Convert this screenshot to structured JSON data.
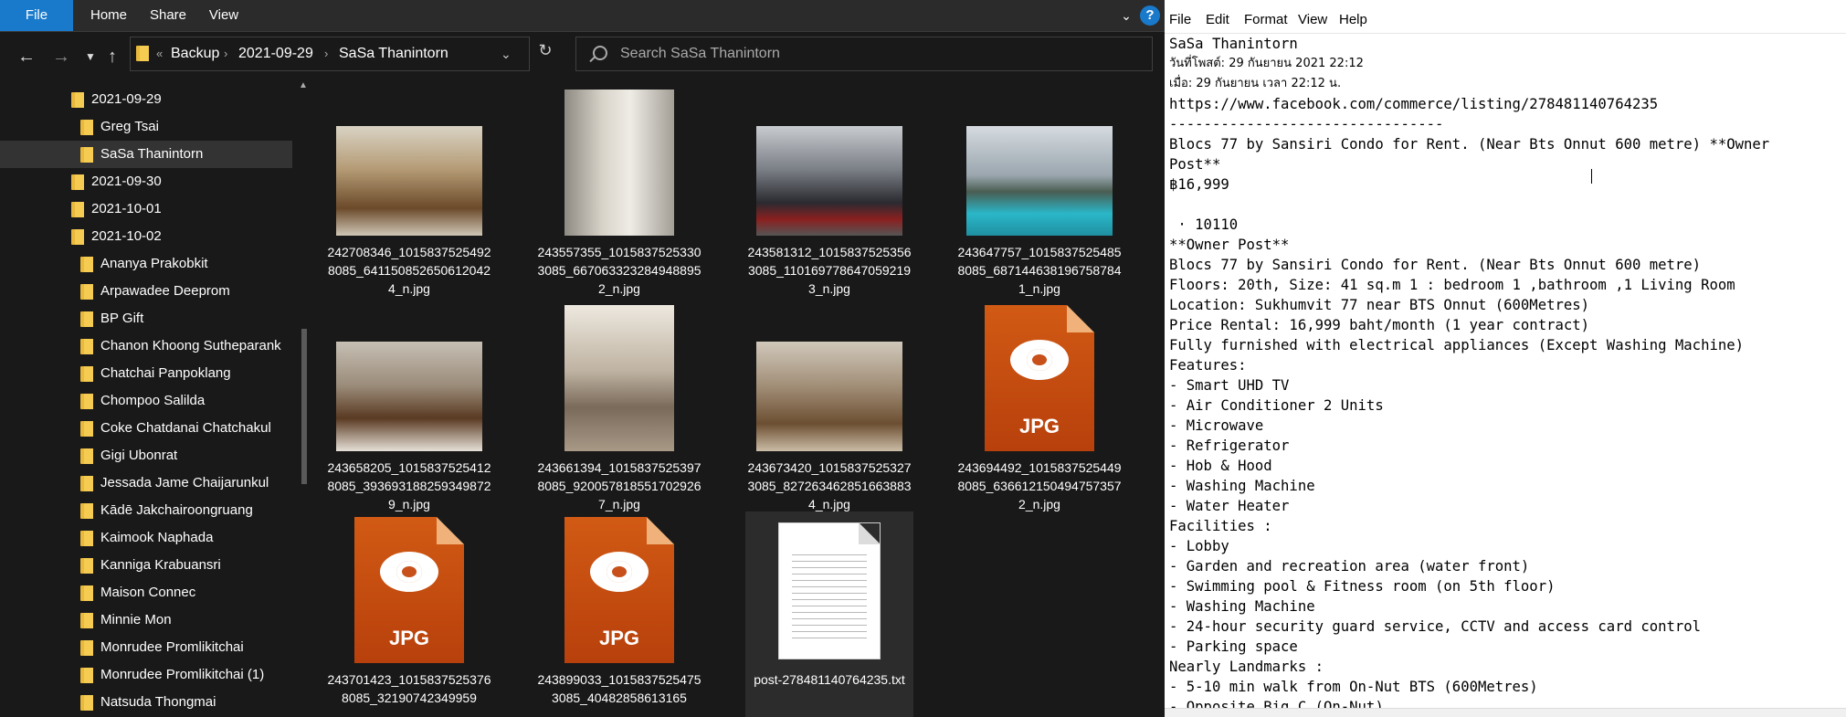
{
  "explorer": {
    "ribbon": {
      "file": "File",
      "home": "Home",
      "share": "Share",
      "view": "View",
      "help": "?"
    },
    "address": {
      "overflow": "«",
      "crumbs": [
        "Backup",
        "2021-09-29",
        "SaSa Thanintorn"
      ]
    },
    "search": {
      "placeholder": "Search SaSa Thanintorn"
    },
    "tree": [
      {
        "label": "2021-09-29",
        "indent": 0
      },
      {
        "label": "Greg Tsai",
        "indent": 1
      },
      {
        "label": "SaSa Thanintorn",
        "indent": 1,
        "selected": true
      },
      {
        "label": "2021-09-30",
        "indent": 0
      },
      {
        "label": "2021-10-01",
        "indent": 0
      },
      {
        "label": "2021-10-02",
        "indent": 0
      },
      {
        "label": "Ananya Prakobkit",
        "indent": 1
      },
      {
        "label": "Arpawadee Deeprom",
        "indent": 1
      },
      {
        "label": "BP Gift",
        "indent": 1
      },
      {
        "label": "Chanon Khoong Sutheparank",
        "indent": 1
      },
      {
        "label": "Chatchai Panpoklang",
        "indent": 1
      },
      {
        "label": "Chompoo Salilda",
        "indent": 1
      },
      {
        "label": "Coke Chatdanai Chatchakul",
        "indent": 1
      },
      {
        "label": "Gigi Ubonrat",
        "indent": 1
      },
      {
        "label": "Jessada Jame Chaijarunkul",
        "indent": 1
      },
      {
        "label": "Kādē Jakchairoongruang",
        "indent": 1
      },
      {
        "label": "Kaimook Naphada",
        "indent": 1
      },
      {
        "label": "Kanniga Krabuansri",
        "indent": 1
      },
      {
        "label": "Maison Connec",
        "indent": 1
      },
      {
        "label": "Minnie Mon",
        "indent": 1
      },
      {
        "label": "Monrudee Promlikitchai",
        "indent": 1
      },
      {
        "label": "Monrudee Promlikitchai (1)",
        "indent": 1
      },
      {
        "label": "Natsuda Thongmai",
        "indent": 1
      }
    ],
    "files": [
      {
        "name": "242708346_10158375254928085_6411508526506120424_n.jpg",
        "kind": "photo",
        "variant": "kitchen"
      },
      {
        "name": "243557355_10158375253303085_6670633232849488952_n.jpg",
        "kind": "photo",
        "variant": "bath"
      },
      {
        "name": "243581312_10158375253563085_1101697786470592193_n.jpg",
        "kind": "photo",
        "variant": "gym"
      },
      {
        "name": "243647757_10158375254858085_6871446381967587841_n.jpg",
        "kind": "photo",
        "variant": "pool"
      },
      {
        "name": "243658205_10158375254128085_3936931882593498729_n.jpg",
        "kind": "photo",
        "variant": "bed"
      },
      {
        "name": "243661394_10158375253978085_9200578185517029267_n.jpg",
        "kind": "photo",
        "variant": "living"
      },
      {
        "name": "243673420_10158375253273085_8272634628516638834_n.jpg",
        "kind": "photo",
        "variant": "room"
      },
      {
        "name": "243694492_10158375254498085_6366121504947573572_n.jpg",
        "kind": "jpg",
        "label": "JPG"
      },
      {
        "name": "243701423_10158375253768085_32190742349959",
        "kind": "jpg",
        "label": "JPG"
      },
      {
        "name": "243899033_10158375254753085_40482858613165",
        "kind": "jpg",
        "label": "JPG"
      },
      {
        "name": "post-278481140764235.txt",
        "kind": "txt",
        "selected": true
      }
    ]
  },
  "notepad": {
    "menu": [
      "File",
      "Edit",
      "Format",
      "View",
      "Help"
    ],
    "lines": [
      {
        "text": "SaSa Thanintorn",
        "small": false
      },
      {
        "text": "วันที่โพสต์: 29 กันยายน 2021 22:12",
        "small": true
      },
      {
        "text": "เมื่อ: 29 กันยายน เวลา 22:12 น.",
        "small": true
      },
      {
        "text": "https://www.facebook.com/commerce/listing/278481140764235",
        "small": false
      },
      {
        "text": "--------------------------------",
        "small": false
      },
      {
        "text": "Blocs 77 by Sansiri Condo for Rent. (Near Bts Onnut 600 metre) **Owner",
        "small": false
      },
      {
        "text": "Post**",
        "small": false
      },
      {
        "text": "฿16,999",
        "small": false
      },
      {
        "text": "",
        "small": false
      },
      {
        "text": " · 10110",
        "small": false
      },
      {
        "text": "**Owner Post**",
        "small": false
      },
      {
        "text": "Blocs 77 by Sansiri Condo for Rent. (Near Bts Onnut 600 metre)",
        "small": false
      },
      {
        "text": "Floors: 20th, Size: 41 sq.m 1 : bedroom 1 ,bathroom ,1 Living Room",
        "small": false
      },
      {
        "text": "Location: Sukhumvit 77 near BTS Onnut (600Metres)",
        "small": false
      },
      {
        "text": "Price Rental: 16,999 baht/month (1 year contract)",
        "small": false
      },
      {
        "text": "Fully furnished with electrical appliances (Except Washing Machine)",
        "small": false
      },
      {
        "text": "Features:",
        "small": false
      },
      {
        "text": "- Smart UHD TV",
        "small": false
      },
      {
        "text": "- Air Conditioner 2 Units",
        "small": false
      },
      {
        "text": "- Microwave",
        "small": false
      },
      {
        "text": "- Refrigerator",
        "small": false
      },
      {
        "text": "- Hob & Hood",
        "small": false
      },
      {
        "text": "- Washing Machine",
        "small": false
      },
      {
        "text": "- Water Heater",
        "small": false
      },
      {
        "text": "Facilities :",
        "small": false
      },
      {
        "text": "- Lobby",
        "small": false
      },
      {
        "text": "- Garden and recreation area (water front)",
        "small": false
      },
      {
        "text": "- Swimming pool & Fitness room (on 5th floor)",
        "small": false
      },
      {
        "text": "- Washing Machine",
        "small": false
      },
      {
        "text": "- 24-hour security guard service, CCTV and access card control",
        "small": false
      },
      {
        "text": "- Parking space",
        "small": false
      },
      {
        "text": "Nearly Landmarks :",
        "small": false
      },
      {
        "text": "- 5-10 min walk from On-Nut BTS (600Metres)",
        "small": false
      },
      {
        "text": "- Opposite Big C (On-Nut)",
        "small": false
      }
    ]
  }
}
